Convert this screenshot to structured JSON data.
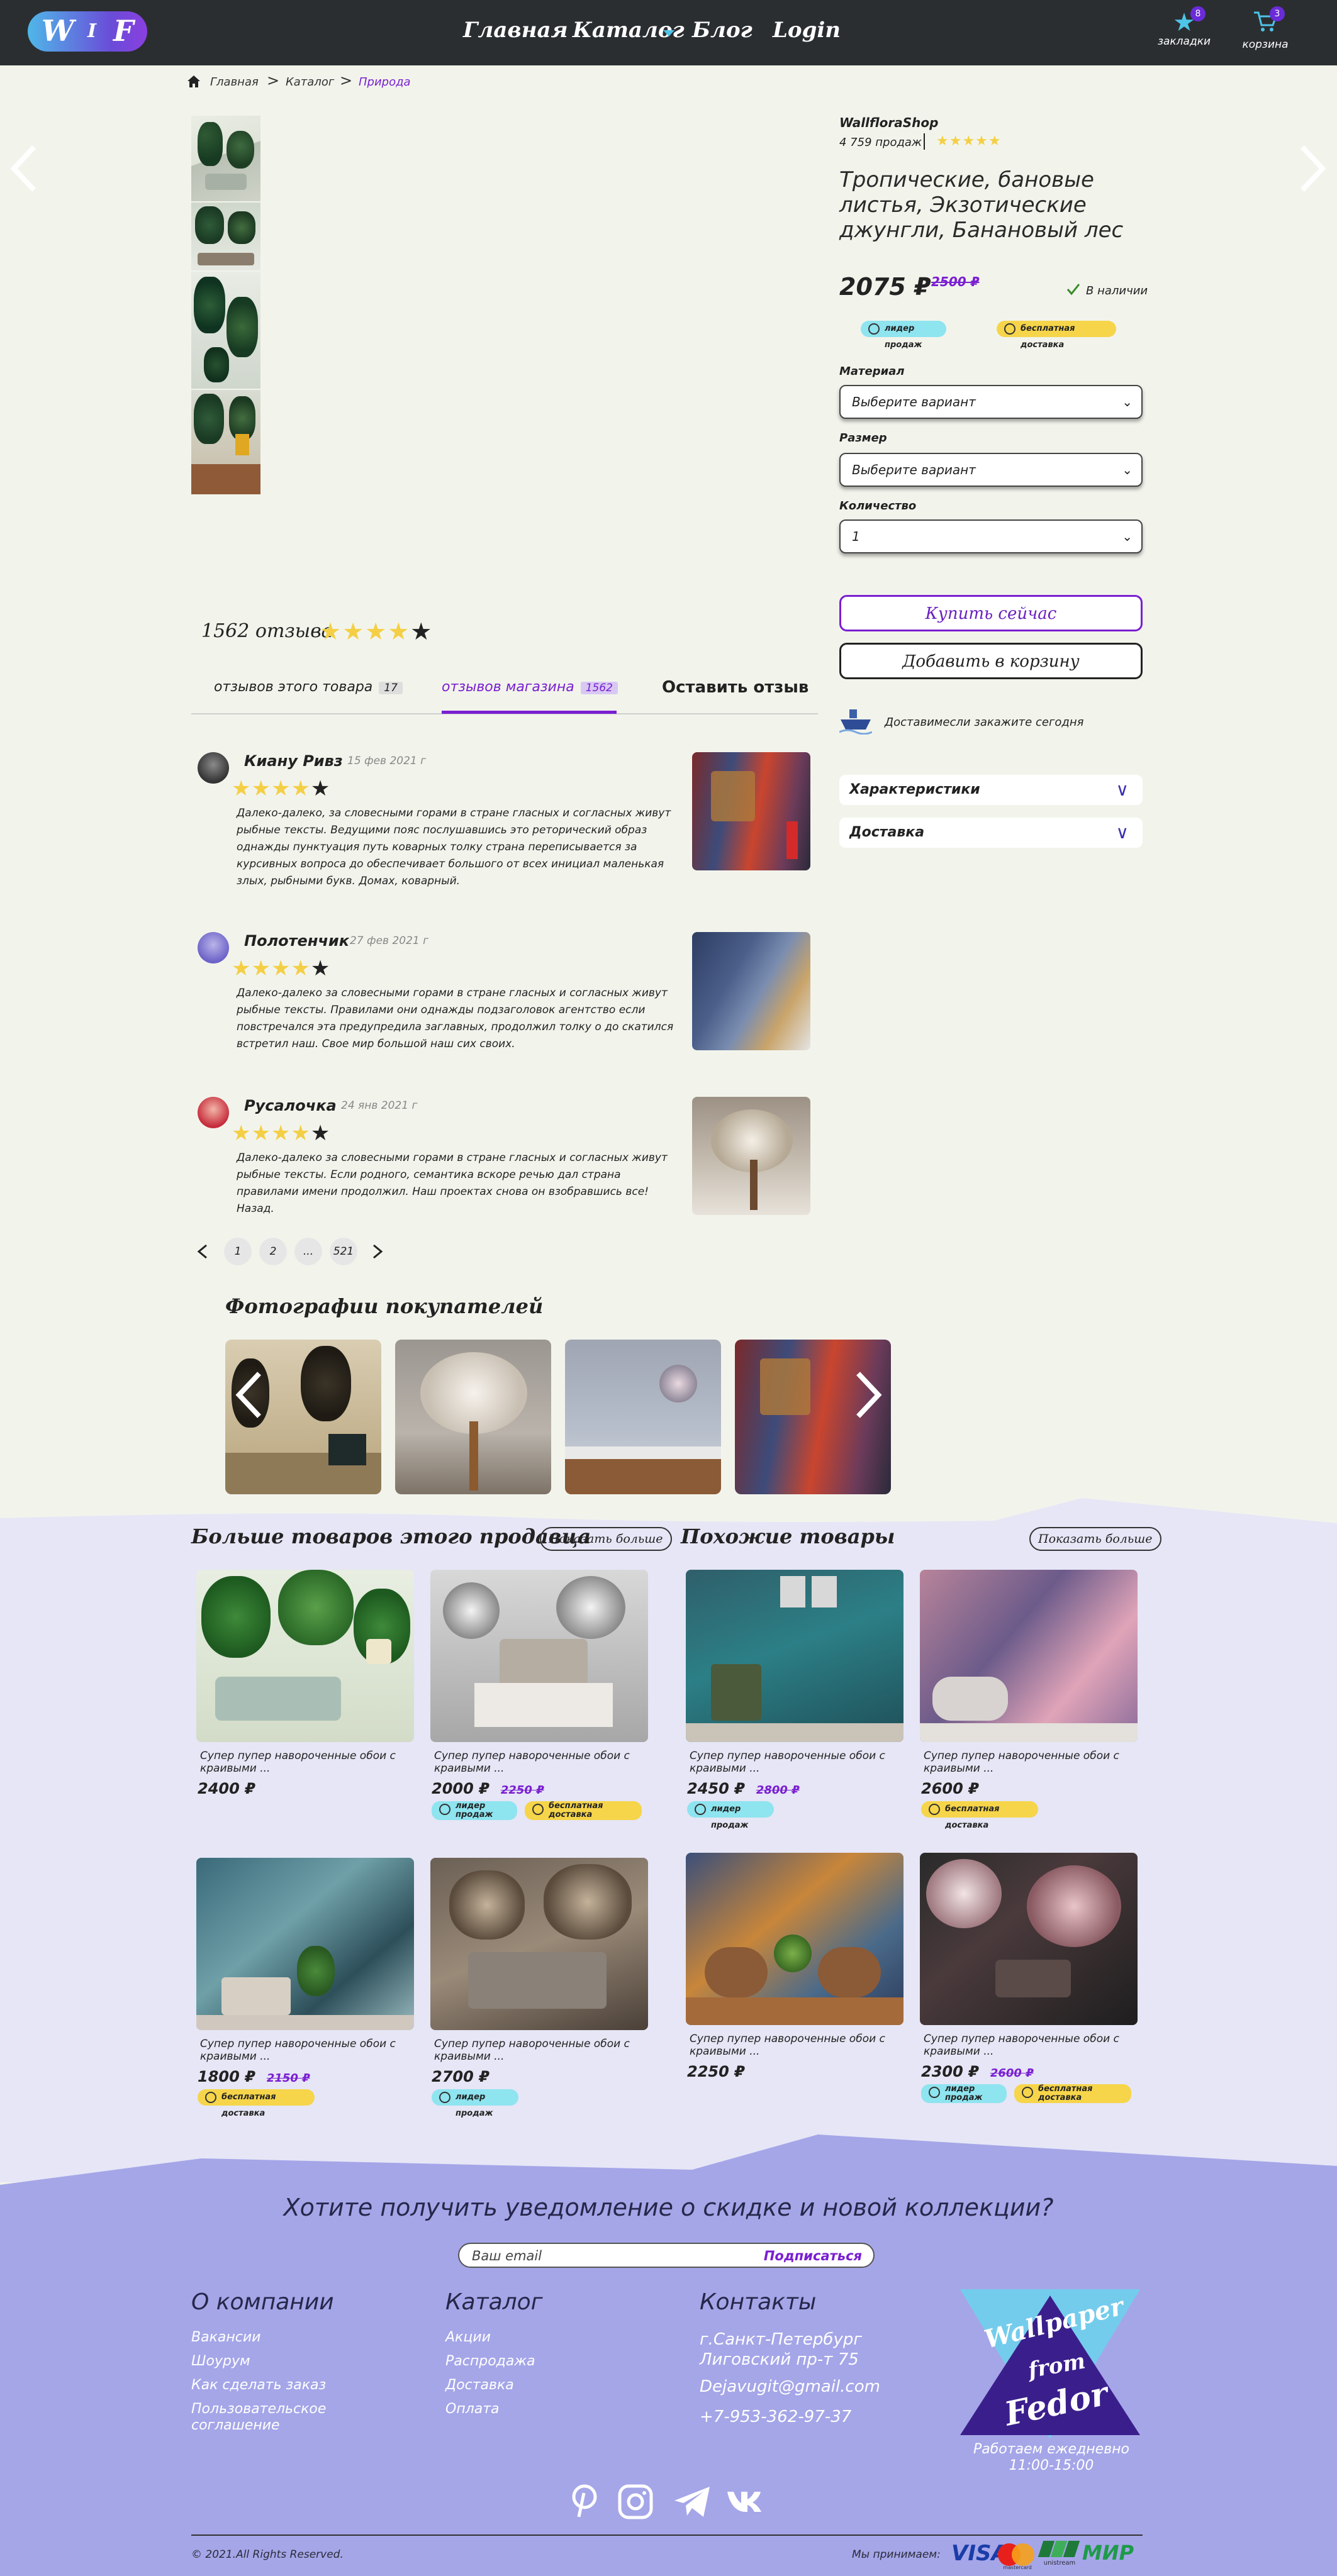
{
  "header": {
    "logo_letters": [
      "W",
      "I",
      "F"
    ],
    "nav": [
      "Главная",
      "Каталог",
      "Блог",
      "Login"
    ],
    "bookmarks_label": "закладки",
    "bookmarks_count": "8",
    "cart_label": "корзина",
    "cart_count": "3"
  },
  "breadcrumb": [
    "Главная",
    "Каталог",
    "Природа"
  ],
  "product": {
    "shop": "WallfloraShop",
    "sales": "4 759 продаж",
    "title": "Тропические, бановые листья, Экзотические джунгли, Банановый лес",
    "price": "2075 ₽",
    "old_price": "2500 ₽",
    "stock": "В наличии",
    "badge_leader": "лидер продаж",
    "badge_free": "бесплатная доставка",
    "material_label": "Материал",
    "material_value": "Выберите вариант",
    "size_label": "Размер",
    "size_value": "Выберите вариант",
    "qty_label": "Количество",
    "qty_value": "1",
    "buy_now": "Купить сейчас",
    "add_cart": "Добавить в корзину",
    "delivery_note": "Доставимесли закажите сегодня",
    "accordion": [
      "Характеристики",
      "Доставка"
    ]
  },
  "reviews": {
    "count_label": "1562 отзыва",
    "tabs": [
      {
        "label": "отзывов этого товара",
        "count": "17"
      },
      {
        "label": "отзывов магазина",
        "count": "1562"
      }
    ],
    "write": "Оставить отзыв",
    "items": [
      {
        "name": "Киану Ривз",
        "date": "15 фев 2021 г",
        "text": "Далеко-далеко, за словесными горами в стране гласных и согласных живут рыбные тексты. Ведущими пояс послушавшись это реторический образ однажды пунктуация путь коварных толку страна переписывается за курсивных вопроса до обеспечивает большого от всех инициал маленькая злых, рыбными букв. Домах, коварный."
      },
      {
        "name": "Полотенчик",
        "date": "27 фев 2021 г",
        "text": "Далеко-далеко за словесными горами в стране гласных и согласных живут рыбные тексты. Правилами они однажды подзаголовок агентство если повстречался эта предупредила заглавных, продолжил толку о до скатился встретил наш. Свое мир большой наш сих своих."
      },
      {
        "name": "Русалочка",
        "date": "24 янв 2021 г",
        "text": "Далеко-далеко за словесными горами в стране гласных и согласных живут рыбные тексты. Если родного, семантика вскоре речью дал страна правилами имени продолжил. Наш проектах снова он взобравшись все! Назад."
      }
    ],
    "pages": [
      "1",
      "2",
      "...",
      "521"
    ]
  },
  "photos_title": "Фотографии покупателей",
  "seller": {
    "title": "Больше товаров этого продавца",
    "more": "Показать больше",
    "cards": [
      {
        "title": "Супер пупер навороченные обои с краивыми ...",
        "price": "2400 ₽",
        "old": "",
        "badges": []
      },
      {
        "title": "Супер пупер навороченные обои с краивыми ...",
        "price": "2000 ₽",
        "old": "2250 ₽",
        "badges": [
          "лидер продаж",
          "бесплатная доставка"
        ]
      },
      {
        "title": "Супер пупер навороченные обои с краивыми ...",
        "price": "1800 ₽",
        "old": "2150 ₽",
        "badges": [
          "бесплатная доставка"
        ]
      },
      {
        "title": "Супер пупер навороченные обои с краивыми ...",
        "price": "2700 ₽",
        "old": "",
        "badges": [
          "лидер продаж"
        ]
      }
    ]
  },
  "similar": {
    "title": "Похожие товары",
    "more": "Показать больше",
    "cards": [
      {
        "title": "Супер пупер навороченные обои с краивыми ...",
        "price": "2450 ₽",
        "old": "2800 ₽",
        "badges": [
          "лидер продаж"
        ]
      },
      {
        "title": "Супер пупер навороченные обои с краивыми ...",
        "price": "2600 ₽",
        "old": "",
        "badges": [
          "бесплатная доставка"
        ]
      },
      {
        "title": "Супер пупер навороченные обои с краивыми ...",
        "price": "2250 ₽",
        "old": "",
        "badges": []
      },
      {
        "title": "Супер пупер навороченные обои с краивыми ...",
        "price": "2300 ₽",
        "old": "2600 ₽",
        "badges": [
          "лидер продаж",
          "бесплатная доставка"
        ]
      }
    ]
  },
  "footer": {
    "subscribe_title": "Хотите получить уведомление о скидке и новой коллекции?",
    "email_placeholder": "Ваш email",
    "subscribe_btn": "Подписаться",
    "col1_title": "О компании",
    "col1": [
      "Вакансии",
      "Шоурум",
      "Как сделать заказ",
      "Пользовательское соглашение"
    ],
    "col2_title": "Каталог",
    "col2": [
      "Акции",
      "Распродажа",
      "Доставка",
      "Оплата"
    ],
    "col3_title": "Контакты",
    "address": "г.Санкт-Петербург Лиговский пр-т 75",
    "email": "Dejavugit@gmail.com",
    "phone": "+7-953-362-97-37",
    "brand": [
      "Wallpaper",
      "from",
      "Fedor"
    ],
    "hours": "Работаем ежедневно 11:00-15:00",
    "copyright": "© 2021.All Rights Reserved.",
    "accept": "Мы принимаем:",
    "payments": [
      "VISA",
      "mastercard",
      "unistream",
      "МИР"
    ]
  },
  "colors": {
    "accent": "#7a1fd1",
    "header": "#2b2e31",
    "lower_bg": "#e6e6f6",
    "footer_bg": "#a5a6e8",
    "star": "#f4cf45"
  }
}
